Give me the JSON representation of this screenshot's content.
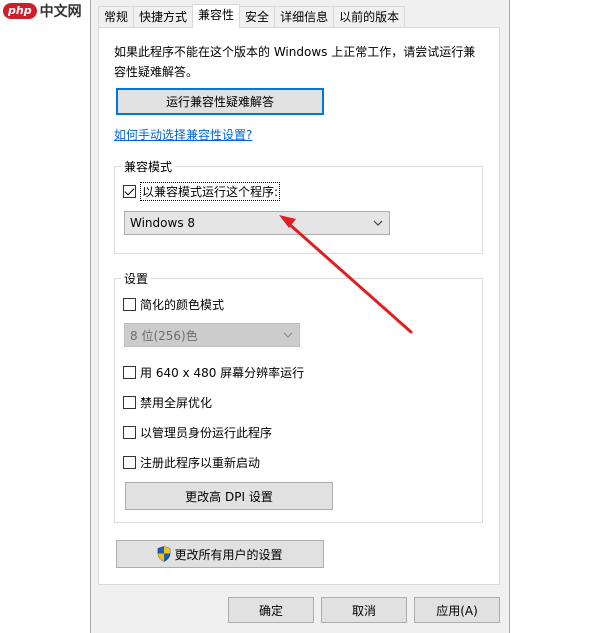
{
  "watermark": {
    "brand": "php",
    "site": "中文网"
  },
  "tabs": [
    {
      "label": "常规",
      "active": false
    },
    {
      "label": "快捷方式",
      "active": false
    },
    {
      "label": "兼容性",
      "active": true
    },
    {
      "label": "安全",
      "active": false
    },
    {
      "label": "详细信息",
      "active": false
    },
    {
      "label": "以前的版本",
      "active": false
    }
  ],
  "compat": {
    "description": "如果此程序不能在这个版本的 Windows 上正常工作，请尝试运行兼容性疑难解答。",
    "troubleshooter_button": "运行兼容性疑难解答",
    "manual_link": "如何手动选择兼容性设置?",
    "mode_group": {
      "title": "兼容模式",
      "checkbox_label": "以兼容模式运行这个程序:",
      "checked": true,
      "selected_os": "Windows 8"
    },
    "settings_group": {
      "title": "设置",
      "reduced_color": {
        "label": "简化的颜色模式",
        "checked": false
      },
      "color_select": "8 位(256)色",
      "res_640": {
        "label": "用 640 x 480 屏幕分辨率运行",
        "checked": false
      },
      "disable_fullscreen": {
        "label": "禁用全屏优化",
        "checked": false
      },
      "run_as_admin": {
        "label": "以管理员身份运行此程序",
        "checked": false
      },
      "register_restart": {
        "label": "注册此程序以重新启动",
        "checked": false
      },
      "dpi_button": "更改高 DPI 设置"
    },
    "all_users_button": "更改所有用户的设置"
  },
  "footer": {
    "ok": "确定",
    "cancel": "取消",
    "apply": "应用(A)"
  },
  "colors": {
    "accent": "#0078d7",
    "link": "#0066cc",
    "arrow": "#e02020",
    "shield_blue": "#1a5fb4",
    "shield_yellow": "#f5c211"
  }
}
